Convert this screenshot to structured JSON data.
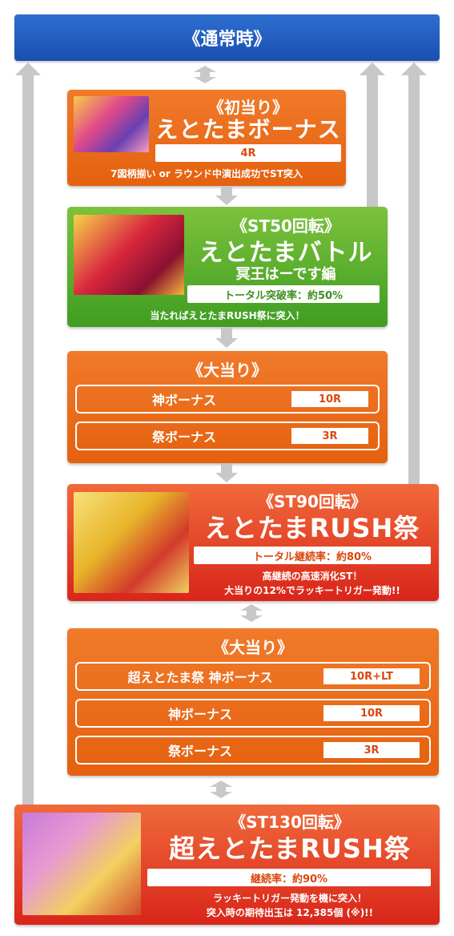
{
  "header": {
    "title": "《通常時》"
  },
  "first_hit": {
    "subtitle": "《初当り》",
    "title": "えとたまボーナス",
    "rounds": "4R",
    "desc": "7図柄揃い or ラウンド中演出成功でST突入"
  },
  "st50": {
    "subtitle": "《ST50回転》",
    "title": "えとたまバトル",
    "sub_title2": "冥王はーです編",
    "rate": "トータル突破率：約50%",
    "desc": "当たればえとたまRUSH祭に突入！"
  },
  "big_hit1": {
    "title": "《大当り》",
    "rows": [
      {
        "label": "神ボーナス",
        "value": "10R"
      },
      {
        "label": "祭ボーナス",
        "value": "3R"
      }
    ]
  },
  "st90": {
    "subtitle": "《ST90回転》",
    "title": "えとたまRUSH祭",
    "rate": "トータル継続率：約80%",
    "desc1": "高継続の高速消化ST！",
    "desc2": "大当りの12%でラッキートリガー発動!!"
  },
  "big_hit2": {
    "title": "《大当り》",
    "rows": [
      {
        "label": "超えとたま祭 神ボーナス",
        "value": "10R+LT"
      },
      {
        "label": "神ボーナス",
        "value": "10R"
      },
      {
        "label": "祭ボーナス",
        "value": "3R"
      }
    ]
  },
  "st130": {
    "subtitle": "《ST130回転》",
    "title": "超えとたまRUSH祭",
    "rate": "継続率：約90%",
    "desc1": "ラッキートリガー発動を機に突入！",
    "desc2": "突入時の期待出玉は 12,385個 (※)!!"
  },
  "colors": {
    "header": "#1f57b8",
    "orange": "#e9691a",
    "green": "#56ad2b",
    "red": "#e0321c",
    "connector": "#c8c8c8"
  }
}
